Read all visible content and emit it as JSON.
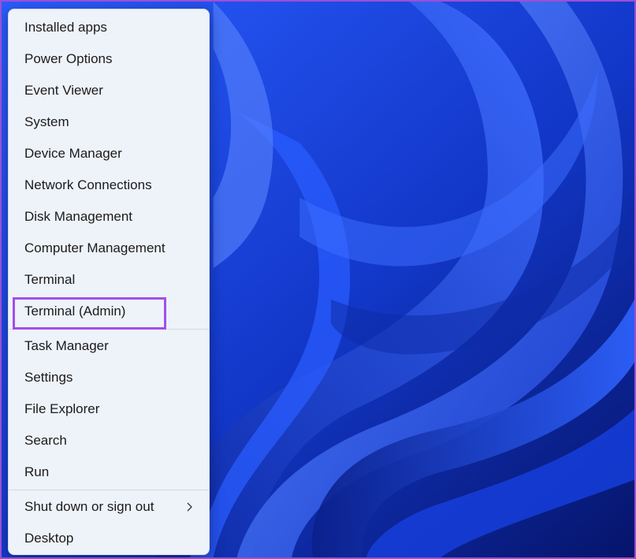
{
  "menu": {
    "items": [
      {
        "label": "Installed apps"
      },
      {
        "label": "Power Options"
      },
      {
        "label": "Event Viewer"
      },
      {
        "label": "System"
      },
      {
        "label": "Device Manager"
      },
      {
        "label": "Network Connections"
      },
      {
        "label": "Disk Management"
      },
      {
        "label": "Computer Management"
      },
      {
        "label": "Terminal"
      },
      {
        "label": "Terminal (Admin)"
      },
      {
        "label": "Task Manager"
      },
      {
        "label": "Settings"
      },
      {
        "label": "File Explorer"
      },
      {
        "label": "Search"
      },
      {
        "label": "Run"
      },
      {
        "label": "Shut down or sign out"
      },
      {
        "label": "Desktop"
      }
    ],
    "highlighted_item": "Terminal (Admin)",
    "submenu_icon": "chevron-right-icon"
  },
  "colors": {
    "highlight_border": "#a24fe8",
    "menu_background": "#eef2f9",
    "wallpaper_accent": "#1f55ff"
  }
}
